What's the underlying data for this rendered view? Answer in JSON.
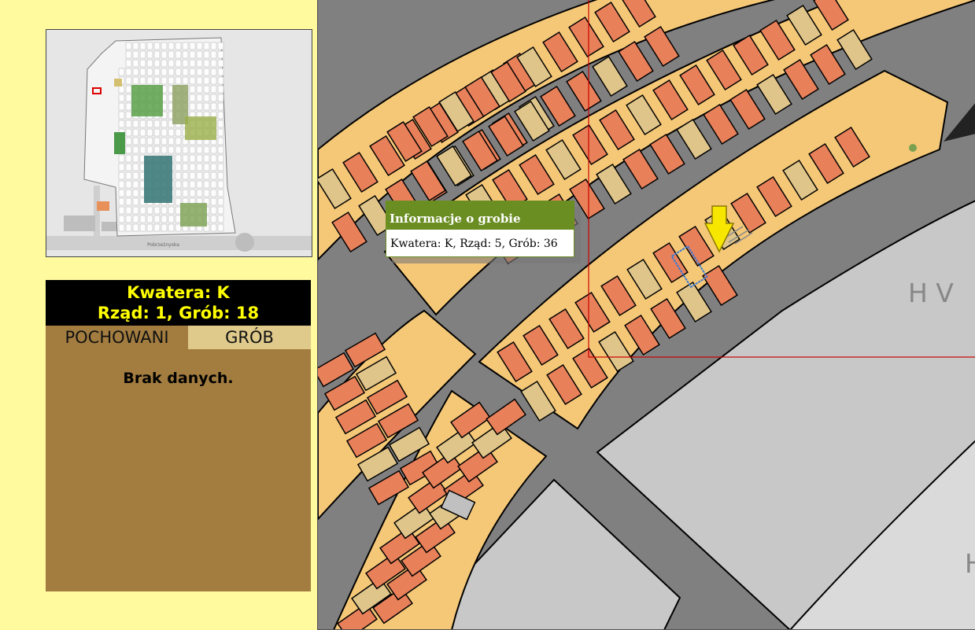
{
  "info_panel": {
    "header_line1": "Kwatera: K",
    "header_line2": "Rząd: 1, Grób: 18",
    "tabs": [
      {
        "label": "POCHOWANI",
        "active": true
      },
      {
        "label": "GRÓB",
        "active": false
      }
    ],
    "empty_message": "Brak danych."
  },
  "popup": {
    "title": "Informacje o grobie",
    "text": "Kwatera: K, Rząd: 5, Grób: 36"
  },
  "map": {
    "section_labels": [
      "H V",
      "H"
    ],
    "marker": "yellow-arrow",
    "colors": {
      "page_bg": "#fffa9e",
      "paths": "#808080",
      "sector": "#f5c878",
      "grave_occupied": "#e8805a",
      "grave_other": "#dfc58a",
      "grave_gray": "#c0c0c0",
      "open_area": "#c8c8c8",
      "selection_frame": "#cc0000",
      "popup_header": "#6b8e23"
    }
  },
  "minimap": {
    "map_label": "Pobrzeżnyska"
  }
}
